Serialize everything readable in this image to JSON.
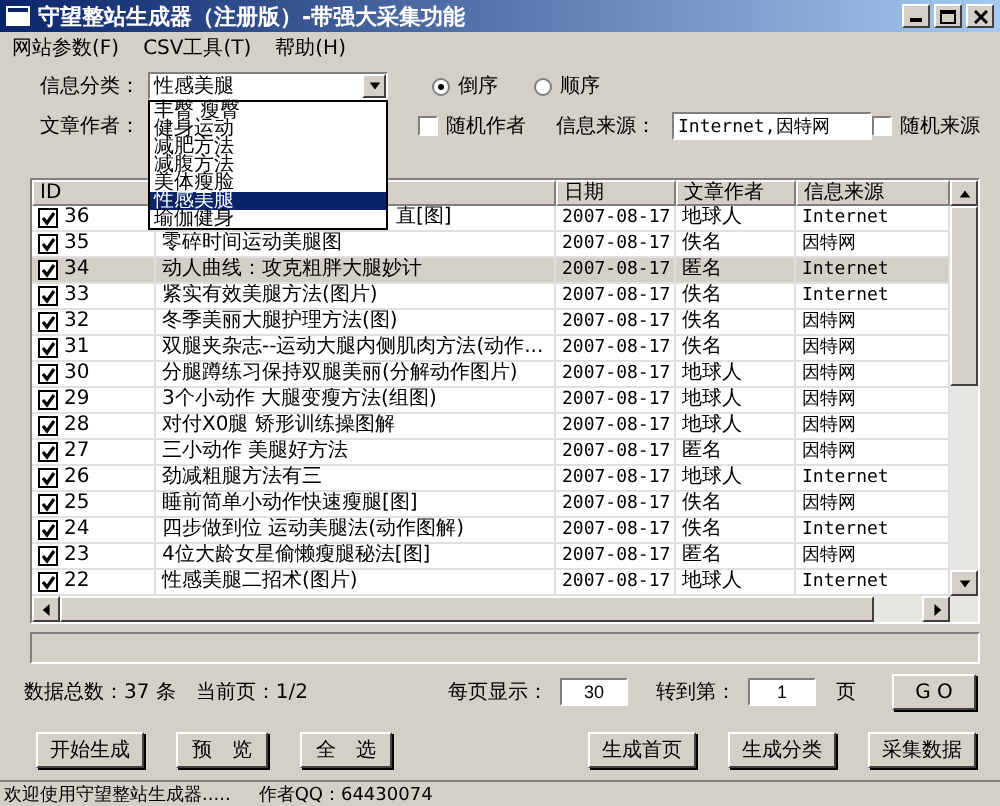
{
  "window": {
    "title": "守望整站生成器（注册版）-带强大采集功能"
  },
  "menu": [
    {
      "label": "网站参数(F)"
    },
    {
      "label": "CSV工具(T)"
    },
    {
      "label": "帮助(H)"
    }
  ],
  "form": {
    "category": {
      "label": "信息分类：",
      "value": "性感美腿",
      "options": [
        {
          "label": "丰臀 瘦臀",
          "selected": false
        },
        {
          "label": "健身运动",
          "selected": false
        },
        {
          "label": "减肥方法",
          "selected": false
        },
        {
          "label": "减腹方法",
          "selected": false
        },
        {
          "label": "美体瘦脸",
          "selected": false
        },
        {
          "label": "性感美腿",
          "selected": true
        },
        {
          "label": "瑜伽健身",
          "selected": false
        }
      ]
    },
    "order": [
      {
        "label": "倒序",
        "selected": true
      },
      {
        "label": "顺序",
        "selected": false
      }
    ],
    "author": {
      "label": "文章作者："
    },
    "random_author": {
      "label": "随机作者",
      "checked": false
    },
    "source": {
      "label": "信息来源：",
      "value": "Internet,因特网"
    },
    "random_source": {
      "label": "随机来源",
      "checked": false
    }
  },
  "table": {
    "columns": [
      {
        "label": "ID"
      },
      {
        "label": "日期"
      },
      {
        "label": "文章作者"
      },
      {
        "label": "信息来源"
      }
    ],
    "rows": [
      {
        "checked": true,
        "id": "36",
        "title": "直[图]",
        "covered": true,
        "date": "2007-08-17",
        "author": "地球人",
        "source": "Internet",
        "selected": false
      },
      {
        "checked": true,
        "id": "35",
        "title": "零碎时间运动美腿图",
        "covered": false,
        "date": "2007-08-17",
        "author": "佚名",
        "source": "因特网",
        "selected": false
      },
      {
        "checked": true,
        "id": "34",
        "title": "动人曲线：攻克粗胖大腿妙计",
        "covered": false,
        "date": "2007-08-17",
        "author": "匿名",
        "source": "Internet",
        "selected": true
      },
      {
        "checked": true,
        "id": "33",
        "title": "紧实有效美腿方法(图片)",
        "covered": false,
        "date": "2007-08-17",
        "author": "佚名",
        "source": "Internet",
        "selected": false
      },
      {
        "checked": true,
        "id": "32",
        "title": "冬季美丽大腿护理方法(图)",
        "covered": false,
        "date": "2007-08-17",
        "author": "佚名",
        "source": "因特网",
        "selected": false
      },
      {
        "checked": true,
        "id": "31",
        "title": "双腿夹杂志--运动大腿内侧肌肉方法(动作...",
        "covered": false,
        "date": "2007-08-17",
        "author": "佚名",
        "source": "因特网",
        "selected": false
      },
      {
        "checked": true,
        "id": "30",
        "title": "分腿蹲练习保持双腿美丽(分解动作图片)",
        "covered": false,
        "date": "2007-08-17",
        "author": "地球人",
        "source": "因特网",
        "selected": false
      },
      {
        "checked": true,
        "id": "29",
        "title": "3个小动作 大腿变瘦方法(组图)",
        "covered": false,
        "date": "2007-08-17",
        "author": "地球人",
        "source": "因特网",
        "selected": false
      },
      {
        "checked": true,
        "id": "28",
        "title": "对付X0腿 矫形训练操图解",
        "covered": false,
        "date": "2007-08-17",
        "author": "地球人",
        "source": "因特网",
        "selected": false
      },
      {
        "checked": true,
        "id": "27",
        "title": "三小动作 美腿好方法",
        "covered": false,
        "date": "2007-08-17",
        "author": "匿名",
        "source": "因特网",
        "selected": false
      },
      {
        "checked": true,
        "id": "26",
        "title": "劲减粗腿方法有三",
        "covered": false,
        "date": "2007-08-17",
        "author": "地球人",
        "source": "Internet",
        "selected": false
      },
      {
        "checked": true,
        "id": "25",
        "title": "睡前简单小动作快速瘦腿[图]",
        "covered": false,
        "date": "2007-08-17",
        "author": "佚名",
        "source": "因特网",
        "selected": false
      },
      {
        "checked": true,
        "id": "24",
        "title": "四步做到位 运动美腿法(动作图解)",
        "covered": false,
        "date": "2007-08-17",
        "author": "佚名",
        "source": "Internet",
        "selected": false
      },
      {
        "checked": true,
        "id": "23",
        "title": "4位大龄女星偷懒瘦腿秘法[图]",
        "covered": false,
        "date": "2007-08-17",
        "author": "匿名",
        "source": "因特网",
        "selected": false
      },
      {
        "checked": true,
        "id": "22",
        "title": "性感美腿二招术(图片)",
        "covered": false,
        "date": "2007-08-17",
        "author": "地球人",
        "source": "Internet",
        "selected": false
      }
    ]
  },
  "pager": {
    "total": "数据总数：37 条",
    "current": "当前页：1/2",
    "per_page_label": "每页显示：",
    "per_page": "30",
    "goto_label": "转到第：",
    "goto": "1",
    "page_unit": "页",
    "go": "G O"
  },
  "buttons_left": [
    "开始生成",
    "预　览",
    "全　选"
  ],
  "buttons_right": [
    "生成首页",
    "生成分类",
    "采集数据"
  ],
  "status_bar": {
    "message": "欢迎使用守望整站生成器.....",
    "author": "作者QQ：64430074"
  }
}
